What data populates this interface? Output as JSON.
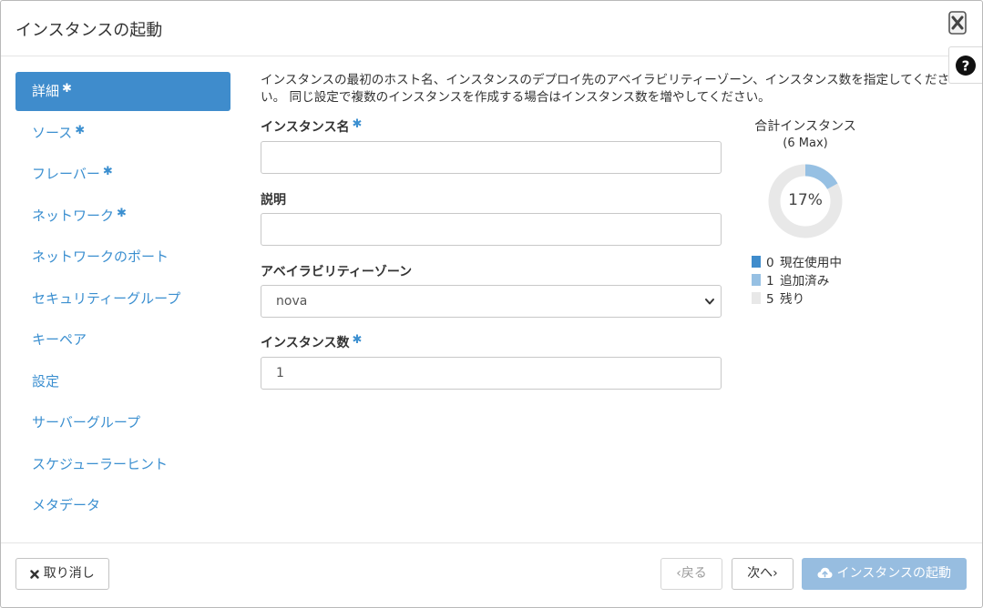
{
  "dialog": {
    "title": "インスタンスの起動",
    "close_icon": "close-icon",
    "help_icon": "question-circle-icon"
  },
  "nav": {
    "items": [
      {
        "label": "詳細",
        "required": "✱",
        "active": true
      },
      {
        "label": "ソース",
        "required": "✱"
      },
      {
        "label": "フレーバー",
        "required": "✱"
      },
      {
        "label": "ネットワーク",
        "required": "✱"
      },
      {
        "label": "ネットワークのポート"
      },
      {
        "label": "セキュリティーグループ"
      },
      {
        "label": "キーペア"
      },
      {
        "label": "設定"
      },
      {
        "label": "サーバーグループ"
      },
      {
        "label": "スケジューラーヒント"
      },
      {
        "label": "メタデータ"
      }
    ]
  },
  "main": {
    "description": "インスタンスの最初のホスト名、インスタンスのデプロイ先のアベイラビリティーゾーン、インスタンス数を指定してください。 同じ設定で複数のインスタンスを作成する場合はインスタンス数を増やしてください。",
    "instance_name": {
      "label": "インスタンス名",
      "required": "✱",
      "value": ""
    },
    "description_field": {
      "label": "説明",
      "value": ""
    },
    "availability_zone": {
      "label": "アベイラビリティーゾーン",
      "value": "nova"
    },
    "instance_count": {
      "label": "インスタンス数",
      "required": "✱",
      "value": "1"
    }
  },
  "quota": {
    "title": "合計インスタンス",
    "max": "(6 Max)",
    "percent_label": "17%",
    "percent": 0.17,
    "colors": {
      "current": "#3f8ccc",
      "added": "#96c0e3",
      "remaining": "#e8e8e8"
    },
    "legend": [
      {
        "count": "0",
        "label": "現在使用中"
      },
      {
        "count": "1",
        "label": "追加済み"
      },
      {
        "count": "5",
        "label": "残り"
      }
    ]
  },
  "footer": {
    "cancel_icon": "times-icon",
    "cancel_label": "取り消し",
    "back_label": "‹戻る",
    "next_label": "次へ›",
    "launch_icon": "cloud-upload-icon",
    "launch_label": "インスタンスの起動"
  }
}
